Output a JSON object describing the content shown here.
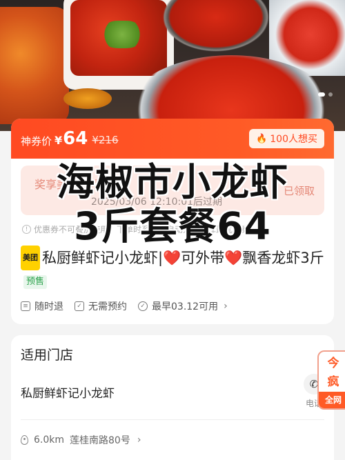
{
  "deal": {
    "price_label": "神券价",
    "currency": "¥",
    "price": "64",
    "original_price": "¥216",
    "want_count": "100人想买"
  },
  "coupon": {
    "left_text": "奖享美味 领购买",
    "right_text": "已领取",
    "expiry": "2025/03/06 12:10:01后过期"
  },
  "notice": "优惠券不可叠加使用，下单时系统将自动为您选择最优惠券！",
  "product": {
    "brand": "美团",
    "title_part1": "私厨鲜虾记小龙虾|",
    "title_part2": "可外带",
    "title_part3": "飘香龙虾3斤",
    "heart": "❤️",
    "presale": "预售"
  },
  "features": [
    {
      "icon": "refund-icon",
      "label": "随时退"
    },
    {
      "icon": "calendar-check-icon",
      "label": "无需预约"
    },
    {
      "icon": "clock-check-icon",
      "label": "最早03.12可用"
    }
  ],
  "overlay": {
    "line1": "海椒市小龙虾",
    "line2": "3斤套餐64"
  },
  "stores": {
    "title": "适用门店",
    "store_name": "私厨鲜虾记小龙虾",
    "phone_label": "电话",
    "distance": "6.0km",
    "address": "莲桂南路80号"
  },
  "side_badge": {
    "top": "今",
    "mid": "疯",
    "bottom": "全网"
  },
  "colors": {
    "accent": "#ff4a22",
    "heart": "#e8161c",
    "presale_green": "#2aa14a"
  }
}
